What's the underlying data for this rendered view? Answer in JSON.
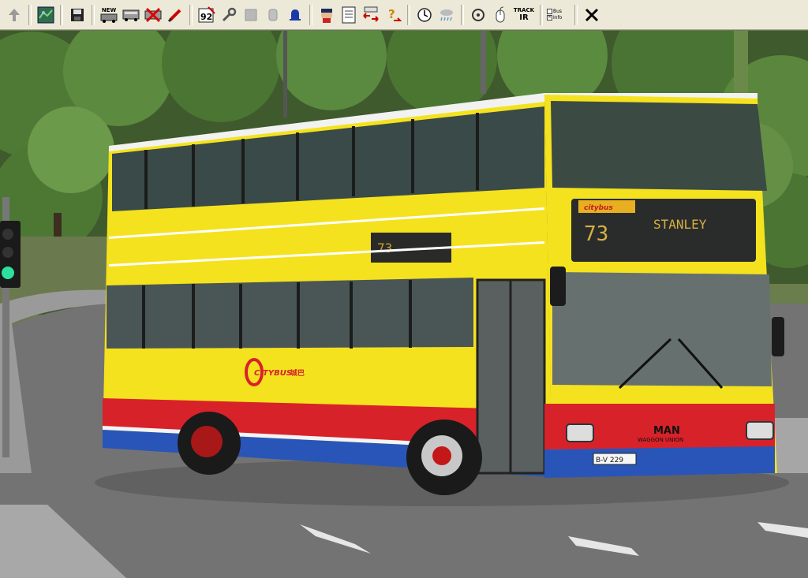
{
  "toolbar": {
    "new_label": "NEW",
    "track_label_top": "TRACK",
    "track_label_bottom": "IR",
    "timetable_label": "92",
    "check_option_1": "Bus",
    "check_option_2": "Info",
    "buttons": [
      {
        "name": "up-arrow-icon"
      },
      {
        "name": "map-icon"
      },
      {
        "name": "save-icon"
      },
      {
        "name": "new-bus-icon"
      },
      {
        "name": "bus-icon"
      },
      {
        "name": "delete-bus-icon"
      },
      {
        "name": "pencil-icon"
      },
      {
        "name": "timetable-icon"
      },
      {
        "name": "wrench-icon"
      },
      {
        "name": "gray-box-icon"
      },
      {
        "name": "gray-cylinder-icon"
      },
      {
        "name": "bell-icon"
      },
      {
        "name": "driver-icon"
      },
      {
        "name": "document-icon"
      },
      {
        "name": "swap-icon"
      },
      {
        "name": "help-icon"
      },
      {
        "name": "clock-icon"
      },
      {
        "name": "weather-icon"
      },
      {
        "name": "camera-icon"
      },
      {
        "name": "mouse-icon"
      },
      {
        "name": "track-ir-icon"
      },
      {
        "name": "checkbox-options"
      },
      {
        "name": "close-icon"
      }
    ]
  },
  "bus": {
    "front_route_number": "73",
    "front_destination": "STANLEY",
    "side_route_number": "73",
    "fleet_number": "229",
    "license_plate": "B-V 229",
    "brand_top": "MAN",
    "brand_bottom": "WAGGON UNION",
    "operator_logo": "CITYBUS",
    "operator_logo_chinese": "城巴",
    "front_display_logo": "citybus"
  },
  "colors": {
    "bus_yellow": "#f4e21e",
    "bus_red": "#d8222a",
    "bus_blue": "#2a55b8",
    "toolbar_bg": "#ece9d8",
    "display_amber": "#e8b020"
  }
}
